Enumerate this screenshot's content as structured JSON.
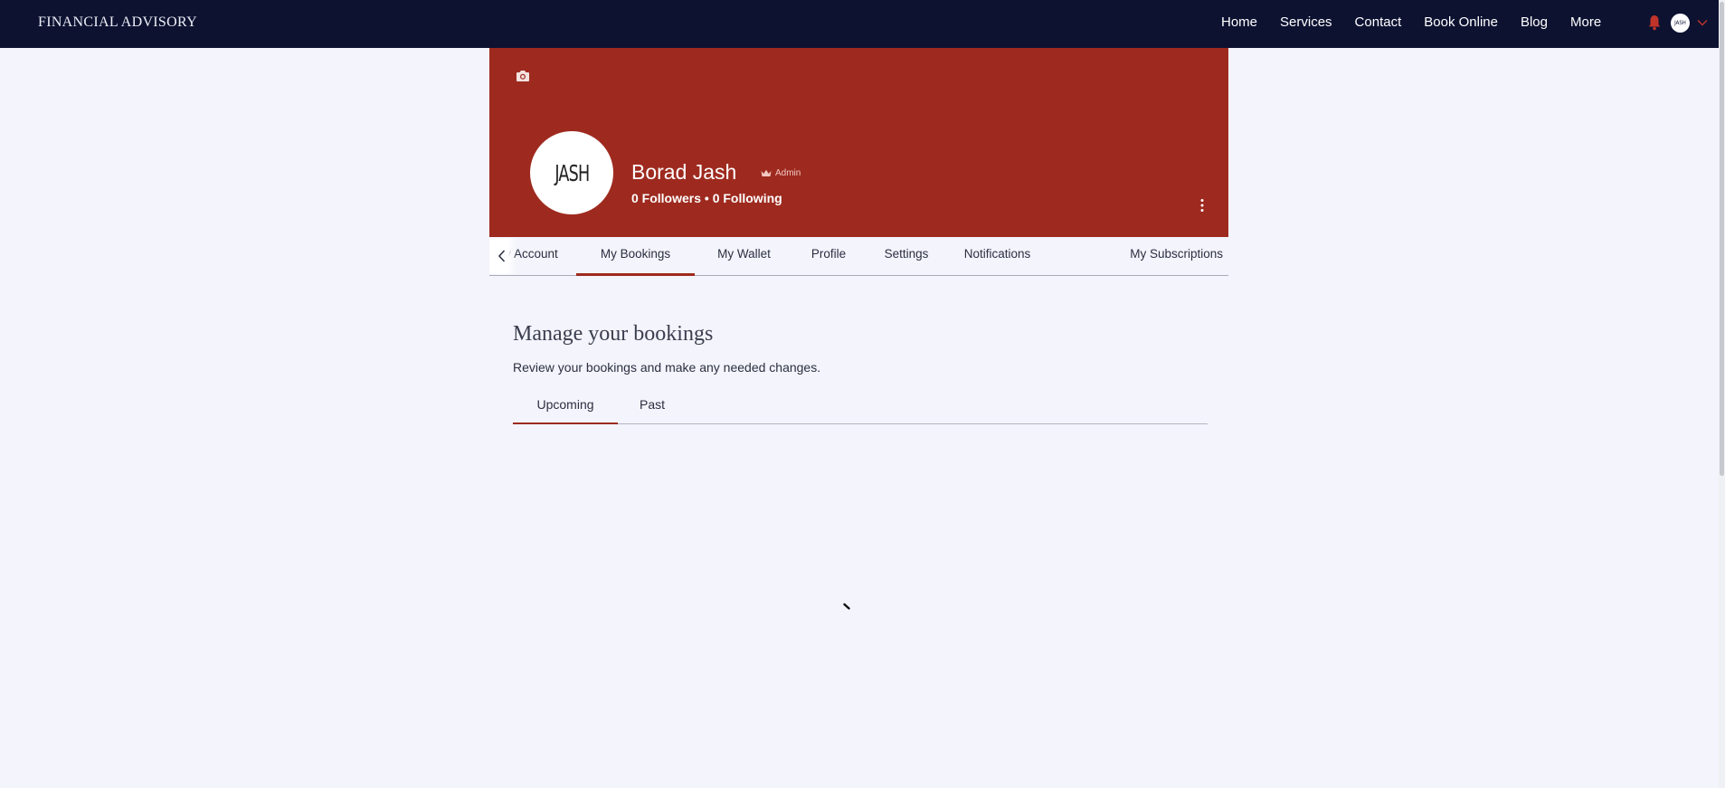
{
  "header": {
    "brand": "FINANCIAL ADVISORY",
    "nav": [
      "Home",
      "Services",
      "Contact",
      "Book Online",
      "Blog",
      "More"
    ],
    "avatar_text": "JASH",
    "bell_color": "#c0342a",
    "bar_color": "#0d1231"
  },
  "profile": {
    "cover_color": "#9e2a1f",
    "avatar_text": "JASH",
    "name": "Borad Jash",
    "role": "Admin",
    "stats": "0 Followers • 0 Following"
  },
  "tabs": {
    "items": [
      "My Account",
      "My Bookings",
      "My Wallet",
      "Profile",
      "Settings",
      "Notifications",
      "My Subscriptions"
    ],
    "active": "My Bookings"
  },
  "main": {
    "title": "Manage your bookings",
    "subtitle": "Review your bookings and make any needed changes.",
    "subtabs": [
      "Upcoming",
      "Past"
    ],
    "active_subtab": "Upcoming"
  },
  "icons": {
    "camera": "camera-icon",
    "bell": "bell-icon",
    "chevron": "chevron-down-icon",
    "kebab": "more-vertical-icon",
    "scroll_left": "chevron-left-icon",
    "crown": "crown-icon",
    "spinner": "loading-spinner-icon"
  }
}
